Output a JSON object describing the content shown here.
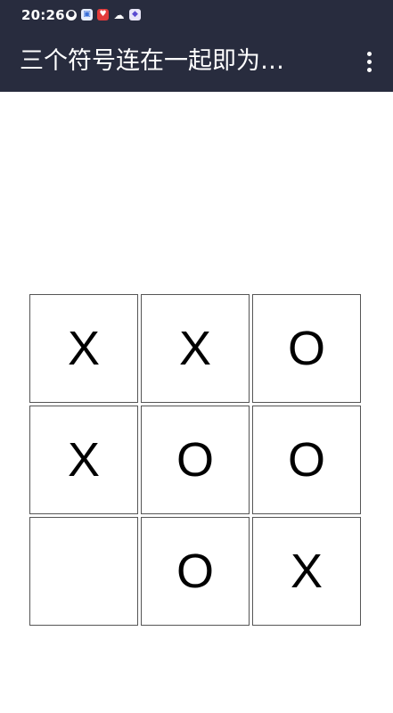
{
  "status_bar": {
    "time": "20:26",
    "icons": [
      "account-icon",
      "app-icon-blue",
      "app-icon-red",
      "weather-icon",
      "app-icon-purple"
    ]
  },
  "toolbar": {
    "title": "三个符号连在一起即为…",
    "overflow_icon": "more-vert-icon"
  },
  "board": {
    "cells": [
      [
        "X",
        "X",
        "O"
      ],
      [
        "X",
        "O",
        "O"
      ],
      [
        "",
        "O",
        "X"
      ]
    ]
  },
  "colors": {
    "app_bar": "#282c3e",
    "background": "#ffffff",
    "cell_border": "#555555",
    "mark": "#000000"
  }
}
